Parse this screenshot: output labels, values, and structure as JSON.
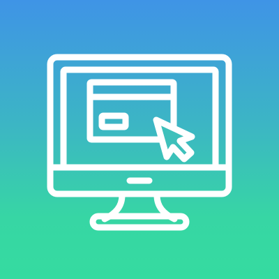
{
  "illustration": {
    "subject": "online-payment-icon",
    "background": {
      "gradient_top": "#3f94e6",
      "gradient_bottom": "#35dba0"
    },
    "stroke_color": "#ffffff",
    "parts": [
      "monitor-icon",
      "browser-window-icon",
      "credit-card-field-icon",
      "mouse-cursor-icon",
      "monitor-stand-icon"
    ]
  }
}
